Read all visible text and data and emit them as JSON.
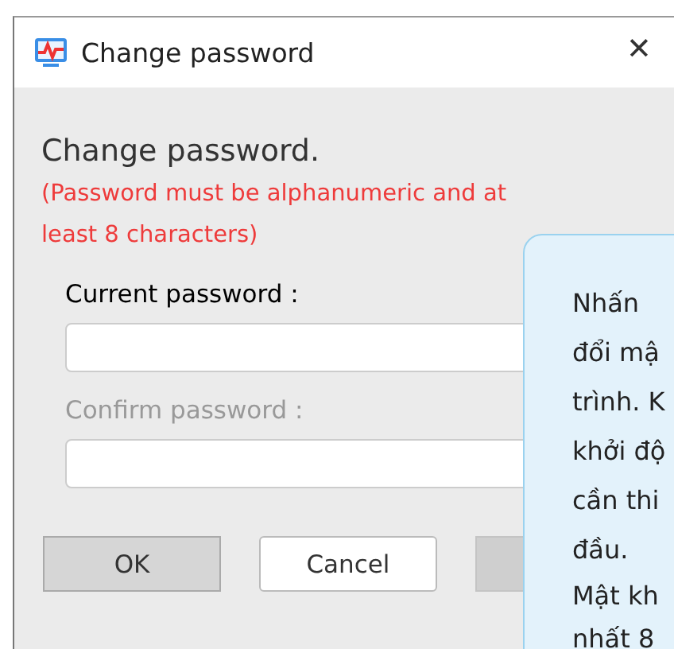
{
  "window": {
    "title": "Change password",
    "close": "✕"
  },
  "heading": "Change password.",
  "warning": "(Password must be alphanumeric and at least 8 characters)",
  "fields": [
    {
      "label": "Current password :",
      "disabled": false
    },
    {
      "label": "Confirm password :",
      "disabled": true
    }
  ],
  "buttons": [
    {
      "label": "OK",
      "kind": "default",
      "disabled": false
    },
    {
      "label": "Cancel",
      "kind": "plain",
      "disabled": false
    },
    {
      "kind": "plain",
      "disabled": true
    }
  ],
  "callout": {
    "lines": [
      "Nhấn",
      "đổi mậ",
      "trình. K",
      "khởi độ",
      "cần thi",
      "đầu.",
      "Mật kh",
      "nhất 8"
    ]
  }
}
